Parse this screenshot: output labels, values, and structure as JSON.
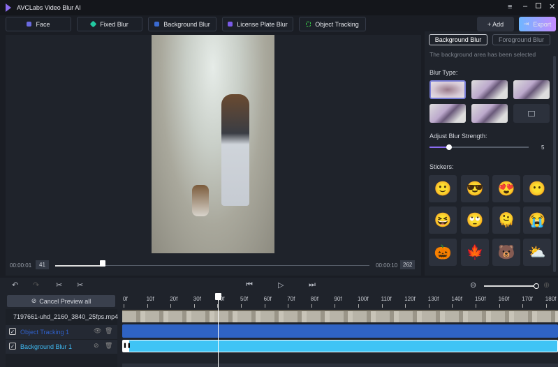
{
  "app": {
    "title": "AVCLabs Video Blur AI",
    "menu_icon": "hamburger-icon",
    "minimize_icon": "minimize-icon",
    "maximize_icon": "maximize-icon",
    "close_icon": "close-icon"
  },
  "toolbar": {
    "tools": [
      {
        "label": "Face",
        "color": "#6a6ae0"
      },
      {
        "label": "Fixed Blur",
        "color": "#22c9a0"
      },
      {
        "label": "Background Blur",
        "color": "#3a6ad0"
      },
      {
        "label": "License Plate Blur",
        "color": "#7a5ae8"
      },
      {
        "label": "Object Tracking",
        "color": "#3ad04a"
      }
    ],
    "add_label": "+ Add",
    "export_label": "Export"
  },
  "preview": {
    "start_time": "00:00:01",
    "start_frame": "41",
    "end_time": "00:00:10",
    "end_frame": "262",
    "progress_fraction": 0.15
  },
  "right_panel": {
    "tabs": [
      "Background Blur",
      "Foreground Blur"
    ],
    "active_tab": "Background Blur",
    "status": "The background area has been selected",
    "blur_type_label": "Blur Type:",
    "blur_types": [
      "gaussian",
      "mosaic",
      "motion",
      "stripe",
      "scatter",
      "custom-image"
    ],
    "strength_label": "Adjust Blur Strength:",
    "strength_value": "5",
    "strength_fraction": 0.2,
    "stickers_label": "Stickers:",
    "stickers": [
      "🙂",
      "😎",
      "😍",
      "😶",
      "😆",
      "🙄",
      "🫠",
      "😭",
      "🎃",
      "🍁",
      "🐻",
      "⛅"
    ]
  },
  "timeline": {
    "cancel_preview_label": "Cancel Preview all",
    "ruler": [
      "0f",
      "10f",
      "20f",
      "30f",
      "40f",
      "50f",
      "60f",
      "70f",
      "80f",
      "90f",
      "100f",
      "110f",
      "120f",
      "130f",
      "140f",
      "150f",
      "160f",
      "170f",
      "180f"
    ],
    "video_file": "7197661-uhd_2160_3840_25fps.mp4",
    "tracks": [
      {
        "label": "Object Tracking 1",
        "color": "#2f63c4"
      },
      {
        "label": "Background Blur 1",
        "color": "#3fc4f5"
      }
    ],
    "zoom_fraction": 1.0
  }
}
